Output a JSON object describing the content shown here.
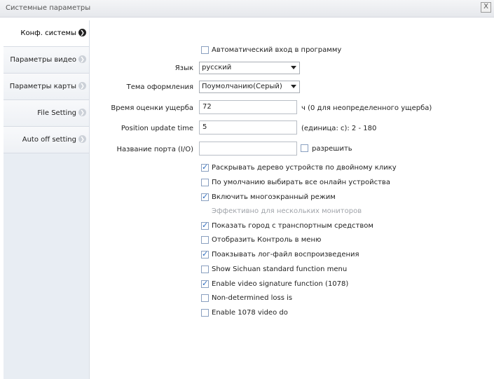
{
  "window": {
    "title": "Системные параметры",
    "close_glyph": "X"
  },
  "sidebar": {
    "items": [
      {
        "label": "Конф. системы",
        "active": true
      },
      {
        "label": "Параметры видео",
        "active": false
      },
      {
        "label": "Параметры карты",
        "active": false
      },
      {
        "label": "File Setting",
        "active": false
      },
      {
        "label": "Auto off setting",
        "active": false
      }
    ]
  },
  "form": {
    "auto_login": {
      "label": "Автоматический вход в программу",
      "checked": false
    },
    "language": {
      "label": "Язык",
      "value": "русский"
    },
    "theme": {
      "label": "Тема оформления",
      "value": "Поумолчанию(Серый)"
    },
    "damage_time": {
      "label": "Время оценки ущерба",
      "value": "72",
      "hint": "ч (0 для неопределенного ущерба)"
    },
    "position_update": {
      "label": "Position update time",
      "value": "5",
      "hint": "(единица: с): 2 - 180"
    },
    "port_name": {
      "label": "Название порта (I/O)",
      "value": "",
      "allow_label": "разрешить",
      "allow_checked": false
    }
  },
  "options": [
    {
      "label": "Раскрывать дерево устройств по двойному клику",
      "checked": true
    },
    {
      "label": "По умолчанию выбирать все онлайн устройства",
      "checked": false
    },
    {
      "label": "Включить многоэкранный режим",
      "checked": true
    },
    {
      "label": "Эффективно для нескольких мониторов",
      "note": true
    },
    {
      "label": "Показать город с транспортным средством",
      "checked": true
    },
    {
      "label": "Отобразить Контроль в меню",
      "checked": false
    },
    {
      "label": "Поакзывать лог-файл воспроизведения",
      "checked": true
    },
    {
      "label": "Show Sichuan standard function menu",
      "checked": false
    },
    {
      "label": "Enable video signature function (1078)",
      "checked": true
    },
    {
      "label": "Non-determined loss is",
      "checked": false
    },
    {
      "label": "Enable 1078 video do",
      "checked": false
    }
  ]
}
